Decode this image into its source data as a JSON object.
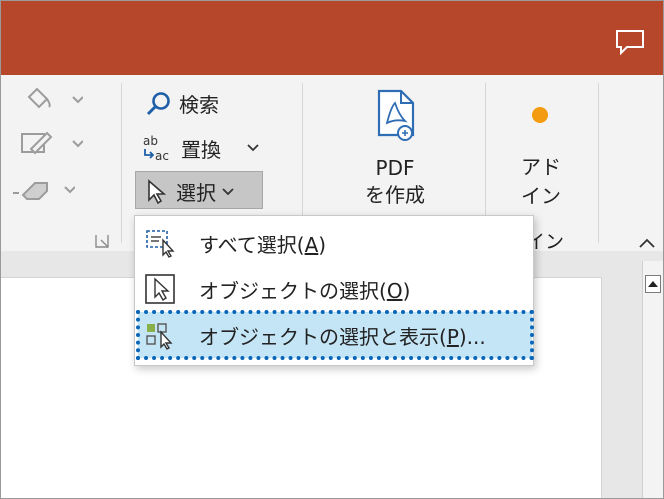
{
  "ribbon": {
    "find_label": "検索",
    "replace_label": "置換",
    "select_label": "選択",
    "pdf_label_line1": "PDF",
    "pdf_label_line2": "を作成",
    "addin_label_line1": "アド",
    "addin_label_line2": "イン"
  },
  "menu": {
    "items": [
      {
        "label": "すべて選択(",
        "key": "A",
        "suffix": ")"
      },
      {
        "label": "オブジェクトの選択(",
        "key": "O",
        "suffix": ")"
      },
      {
        "label": "オブジェクトの選択と表示(",
        "key": "P",
        "suffix": ")..."
      }
    ],
    "partial_label": "イン"
  },
  "colors": {
    "titlebar": "#b7472a",
    "highlight_fill": "#c4e5f6",
    "highlight_outline": "#0a66b8",
    "pdf_icon": "#2f6db5",
    "addin_dot": "#f39c12"
  },
  "icons": [
    "comment-icon",
    "paint-bucket-icon",
    "pen-icon",
    "eraser-icon",
    "search-icon",
    "replace-icon",
    "cursor-icon",
    "chevron-down-icon",
    "pdf-icon",
    "addin-dot-icon",
    "select-all-icon",
    "select-objects-icon",
    "selection-pane-icon",
    "dialog-launcher-icon",
    "collapse-ribbon-icon"
  ]
}
